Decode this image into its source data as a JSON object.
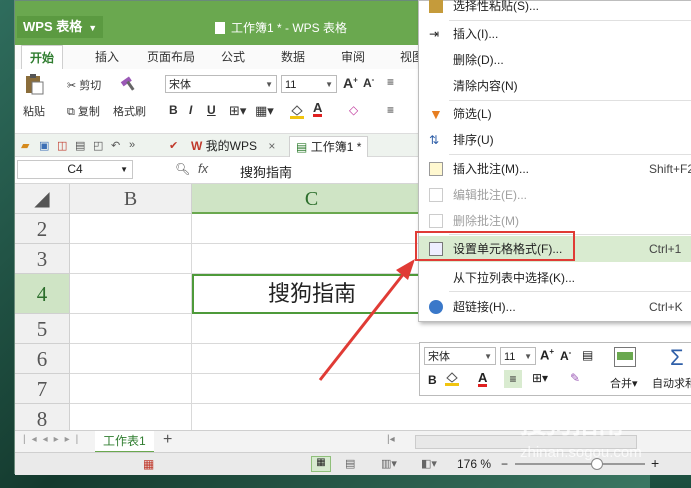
{
  "app": {
    "logo_text": "WPS 表格",
    "window_title": "工作簿1 * - WPS 表格"
  },
  "ribbon_tabs": [
    "开始",
    "插入",
    "页面布局",
    "公式",
    "数据",
    "审阅",
    "视图"
  ],
  "ribbon": {
    "paste": "粘贴",
    "cut": "剪切",
    "copy": "复制",
    "format_painter": "格式刷",
    "font_name": "宋体",
    "font_size": "11",
    "bold": "B",
    "italic": "I",
    "underline": "U"
  },
  "quickbar": {
    "tab_mywps": "我的WPS",
    "tab_workbook": "工作簿1 *"
  },
  "formula_bar": {
    "cell_ref": "C4",
    "fx": "fx",
    "formula_value": "搜狗指南"
  },
  "grid": {
    "columns": [
      "B",
      "C"
    ],
    "rows": [
      "2",
      "3",
      "4",
      "5",
      "6",
      "7",
      "8"
    ],
    "active_cell_value": "搜狗指南"
  },
  "sheet_tabs": [
    "工作表1"
  ],
  "status": {
    "zoom": "176 %"
  },
  "context_menu": [
    {
      "label": "选择性粘贴(S)...",
      "shortcut": "",
      "disabled": false
    },
    {
      "label": "插入(I)...",
      "shortcut": "",
      "disabled": false
    },
    {
      "label": "删除(D)...",
      "shortcut": "",
      "disabled": false
    },
    {
      "label": "清除内容(N)",
      "shortcut": "",
      "disabled": false
    },
    {
      "label": "筛选(L)",
      "shortcut": "",
      "disabled": false
    },
    {
      "label": "排序(U)",
      "shortcut": "",
      "disabled": false
    },
    {
      "label": "插入批注(M)...",
      "shortcut": "Shift+F2",
      "disabled": false
    },
    {
      "label": "编辑批注(E)...",
      "shortcut": "",
      "disabled": true
    },
    {
      "label": "删除批注(M)",
      "shortcut": "",
      "disabled": true
    },
    {
      "label": "设置单元格格式(F)...",
      "shortcut": "Ctrl+1",
      "disabled": false,
      "highlighted": true
    },
    {
      "label": "从下拉列表中选择(K)...",
      "shortcut": "",
      "disabled": false
    },
    {
      "label": "超链接(H)...",
      "shortcut": "Ctrl+K",
      "disabled": false
    }
  ],
  "mini_toolbar": {
    "font_name": "宋体",
    "font_size": "11",
    "merge": "合并",
    "autosum": "自动求和"
  },
  "watermark": {
    "text": "搜狗指南",
    "url": "zhinan.sogou.com"
  },
  "colors": {
    "accent": "#6aa84f",
    "highlight": "#d9ebd0",
    "callout_red": "#e03b35"
  }
}
